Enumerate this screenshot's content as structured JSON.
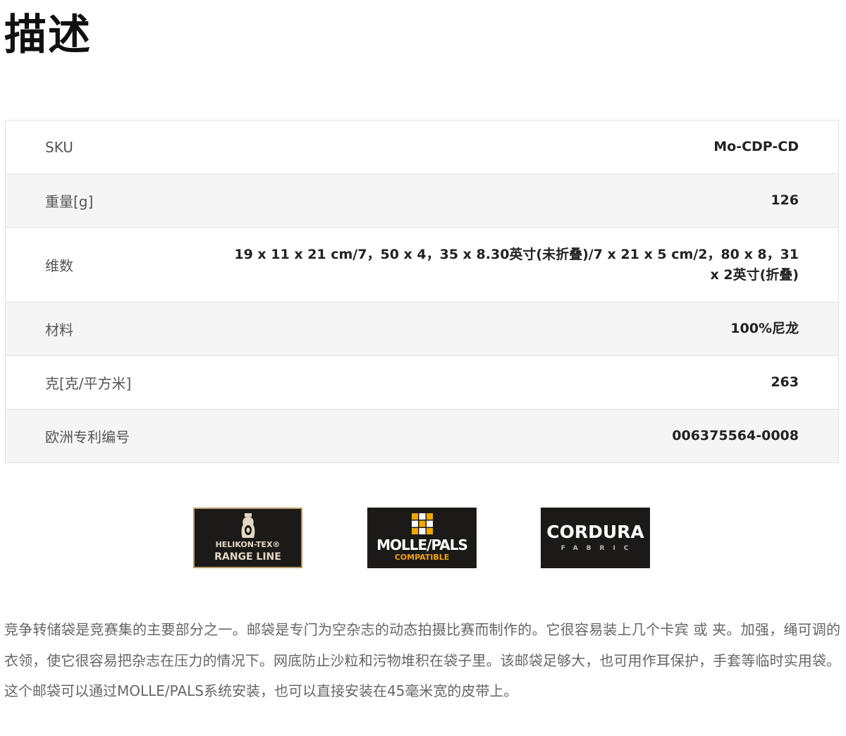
{
  "title": "描述",
  "specs": [
    {
      "label": "SKU",
      "value": "Mo-CDP-CD"
    },
    {
      "label": "重量[g]",
      "value": "126"
    },
    {
      "label": "维数",
      "value": "19 x 11 x 21 cm/7，50 x 4，35 x 8.30英寸(未折叠)/7 x 21 x 5 cm/2，80 x 8，31 x 2英寸(折叠)"
    },
    {
      "label": "材料",
      "value": "100%尼龙"
    },
    {
      "label": "克[克/平方米]",
      "value": "263"
    },
    {
      "label": "欧洲专利编号",
      "value": "006375564-0008"
    }
  ],
  "badges": {
    "helikon": {
      "line1": "HELIKON-TEX®",
      "line2": "RANGE LINE",
      "icon": "target-silhouette-icon"
    },
    "molle": {
      "line1": "MOLLE/PALS",
      "line2": "COMPATIBLE",
      "icon": "grid-squares-icon"
    },
    "cordura": {
      "line1": "CORDURA",
      "line2": "FABRIC"
    }
  },
  "colors": {
    "row_alt_bg": "#f5f5f5",
    "border": "#e2e2e2",
    "badge_bg": "#1c1a18",
    "helikon_border": "#b79a6a",
    "molle_accent": "#f0a800"
  },
  "description": "竞争转储袋是竞赛集的主要部分之一。邮袋是专门为空杂志的动态拍摄比赛而制作的。它很容易装上几个卡宾      或      夹。加强，绳可调的衣领，使它很容易把杂志在压力的情况下。网底防止沙粒和污物堆积在袋子里。该邮袋足够大，也可用作耳保护，手套等临时实用袋。这个邮袋可以通过MOLLE/PALS系统安装，也可以直接安装在45毫米宽的皮带上。"
}
